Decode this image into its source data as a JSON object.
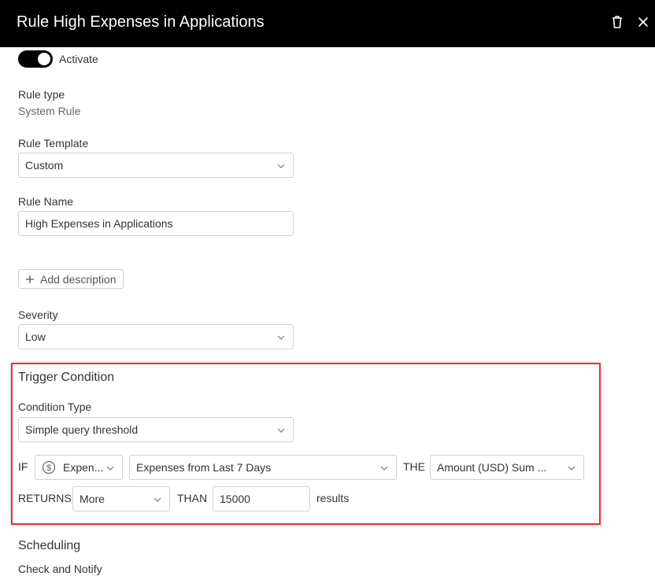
{
  "header": {
    "title": "Rule High Expenses in Applications",
    "delete_icon": "trash-icon",
    "close_icon": "close-icon"
  },
  "activate": {
    "label": "Activate",
    "on": true
  },
  "rule_type": {
    "label": "Rule type",
    "value": "System Rule"
  },
  "rule_template": {
    "label": "Rule Template",
    "value": "Custom"
  },
  "rule_name": {
    "label": "Rule Name",
    "value": "High Expenses in Applications"
  },
  "add_description": {
    "label": "Add description"
  },
  "severity": {
    "label": "Severity",
    "value": "Low"
  },
  "trigger": {
    "title": "Trigger Condition",
    "condition_type_label": "Condition Type",
    "condition_type_value": "Simple query threshold",
    "if_label": "IF",
    "source_value": "Expen...",
    "source_icon": "dollar-circle-icon",
    "query_value": "Expenses from Last 7 Days",
    "the_label": "THE",
    "measure_value": "Amount (USD) Sum ...",
    "returns_label": "RETURNS",
    "comparator_value": "More",
    "than_label": "THAN",
    "threshold_value": "15000",
    "results_label": "results"
  },
  "scheduling": {
    "title": "Scheduling",
    "check_notify_label": "Check and Notify"
  },
  "colors": {
    "header_bg": "#000000",
    "highlight_border": "#e0353d",
    "toggle_on": "#000000"
  }
}
